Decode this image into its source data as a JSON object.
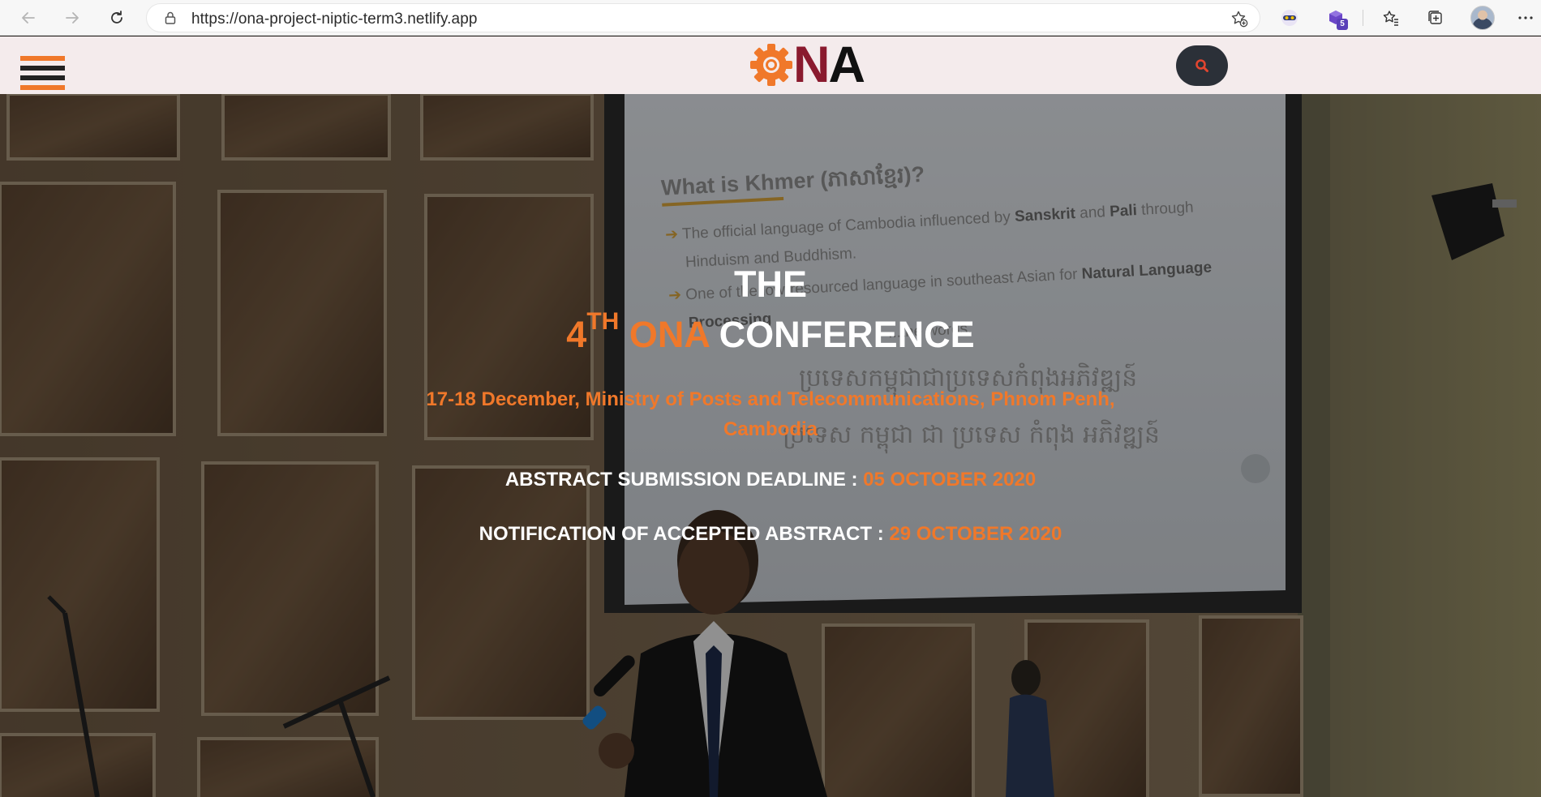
{
  "browser": {
    "url": "https://ona-project-niptic-term3.netlify.app",
    "extensions": [
      {
        "icon": "reader-mask-icon"
      },
      {
        "icon": "puzzle-cube-icon",
        "badge": "5"
      }
    ]
  },
  "header": {
    "logo": {
      "letter1": "N",
      "letter2": "A",
      "gear_color": "#f0782a",
      "n_color": "#8a1a2e",
      "a_color": "#111111"
    },
    "hamburger_colors": [
      "#f0782a",
      "#222222",
      "#222222",
      "#f0782a"
    ],
    "search_icon": "search-icon"
  },
  "hero": {
    "title_line1": "THE",
    "ordinal_number": "4",
    "ordinal_suffix": "TH",
    "brand": "ONA",
    "conference": "CONFERENCE",
    "subtitle": "17-18 December, Ministry of Posts and Telecommunications, Phnom Penh, Cambodia",
    "deadlines": [
      {
        "label": "ABSTRACT SUBMISSION DEADLINE : ",
        "value": "05 OCTOBER 2020"
      },
      {
        "label": "NOTIFICATION OF ACCEPTED ABSTRACT : ",
        "value": "29 OCTOBER 2020"
      }
    ],
    "slide": {
      "title": "What is Khmer (ភាសាខ្មែរ)?",
      "bullet1_a": "The official language of Cambodia influenced by ",
      "bullet1_b": "Sanskrit",
      "bullet1_c": " and ",
      "bullet1_d": "Pali",
      "bullet1_e": " through",
      "bullet1_line2": "Hinduism and Buddhism.",
      "bullet2_a": "One of the low-resourced language in southeast Asian for ",
      "bullet2_b": "Natural Language",
      "bullet2_line2": "Processing",
      "bullet3": "...the words.",
      "khmer_line1": "ប្រទេសកម្ពុជាជាប្រទេសកំពុងអភិវឌ្ឍន៍",
      "khmer_line2": "ប្រទេស កម្ពុជា ជា ប្រទេស កំពុង អភិវឌ្ឍន៍"
    }
  },
  "colors": {
    "accent": "#f0782a",
    "header_bg": "#f4ebec",
    "search_bg": "#2b3038"
  }
}
